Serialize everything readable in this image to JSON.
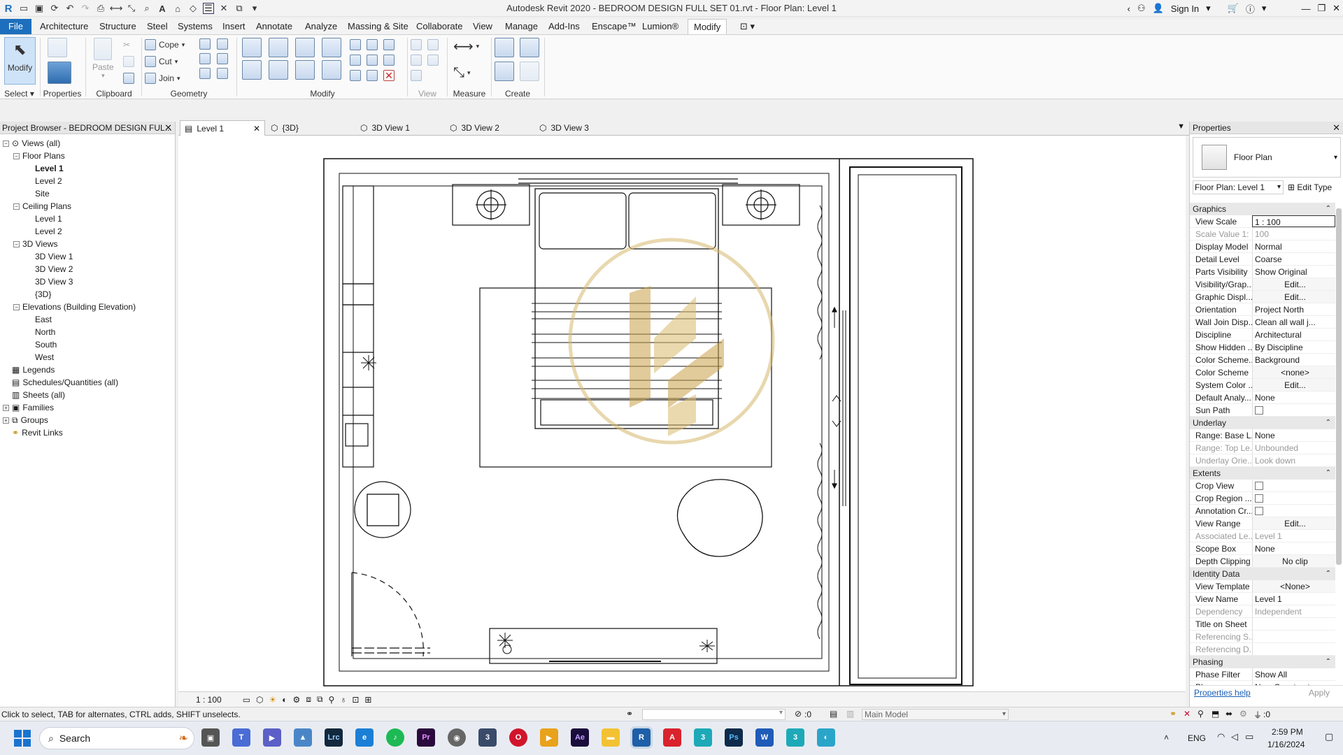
{
  "titlebar": {
    "title": "Autodesk Revit 2020 - BEDROOM DESIGN FULL SET 01.rvt - Floor Plan: Level 1",
    "sign_in": "Sign In"
  },
  "menu": {
    "file": "File",
    "tabs": [
      "Architecture",
      "Structure",
      "Steel",
      "Systems",
      "Insert",
      "Annotate",
      "Analyze",
      "Massing & Site",
      "Collaborate",
      "View",
      "Manage",
      "Add-Ins",
      "Enscape™",
      "Lumion®",
      "Modify"
    ],
    "active": "Modify"
  },
  "ribbon": {
    "select": {
      "modify": "Modify",
      "label": "Select"
    },
    "properties": {
      "label": "Properties"
    },
    "clipboard": {
      "paste": "Paste",
      "label": "Clipboard"
    },
    "geometry": {
      "cope": "Cope",
      "cut": "Cut",
      "join": "Join",
      "label": "Geometry"
    },
    "modify": {
      "label": "Modify"
    },
    "view": {
      "label": "View"
    },
    "measure": {
      "label": "Measure"
    },
    "create": {
      "label": "Create"
    }
  },
  "project_browser": {
    "title": "Project Browser - BEDROOM DESIGN FUL...",
    "tree": [
      {
        "label": "Views (all)",
        "level": 0,
        "exp": "-",
        "icon": "views"
      },
      {
        "label": "Floor Plans",
        "level": 1,
        "exp": "-"
      },
      {
        "label": "Level 1",
        "level": 2,
        "bold": true
      },
      {
        "label": "Level 2",
        "level": 2
      },
      {
        "label": "Site",
        "level": 2
      },
      {
        "label": "Ceiling Plans",
        "level": 1,
        "exp": "-"
      },
      {
        "label": "Level 1",
        "level": 2
      },
      {
        "label": "Level 2",
        "level": 2
      },
      {
        "label": "3D Views",
        "level": 1,
        "exp": "-"
      },
      {
        "label": "3D View 1",
        "level": 2
      },
      {
        "label": "3D View 2",
        "level": 2
      },
      {
        "label": "3D View 3",
        "level": 2
      },
      {
        "label": "{3D}",
        "level": 2
      },
      {
        "label": "Elevations (Building Elevation)",
        "level": 1,
        "exp": "-"
      },
      {
        "label": "East",
        "level": 2
      },
      {
        "label": "North",
        "level": 2
      },
      {
        "label": "South",
        "level": 2
      },
      {
        "label": "West",
        "level": 2
      },
      {
        "label": "Legends",
        "level": 0,
        "icon": "legend"
      },
      {
        "label": "Schedules/Quantities (all)",
        "level": 0,
        "icon": "schedule"
      },
      {
        "label": "Sheets (all)",
        "level": 0,
        "icon": "sheet"
      },
      {
        "label": "Families",
        "level": 0,
        "exp": "+",
        "icon": "family"
      },
      {
        "label": "Groups",
        "level": 0,
        "exp": "+",
        "icon": "group"
      },
      {
        "label": "Revit Links",
        "level": 0,
        "icon": "link"
      }
    ]
  },
  "view_tabs": [
    {
      "label": "Level 1",
      "active": true
    },
    {
      "label": "{3D}"
    },
    {
      "label": "3D View 1"
    },
    {
      "label": "3D View 2"
    },
    {
      "label": "3D View 3"
    }
  ],
  "view_control": {
    "scale": "1 : 100"
  },
  "properties": {
    "title": "Properties",
    "type_name": "Floor Plan",
    "instance": "Floor Plan: Level 1",
    "edit_type": "Edit Type",
    "groups": [
      {
        "name": "Graphics",
        "rows": [
          [
            "View Scale",
            "1 : 100"
          ],
          [
            "Scale Value    1:",
            "100",
            "disabled"
          ],
          [
            "Display Model",
            "Normal"
          ],
          [
            "Detail Level",
            "Coarse"
          ],
          [
            "Parts Visibility",
            "Show Original"
          ],
          [
            "Visibility/Grap...",
            "Edit...",
            "button"
          ],
          [
            "Graphic Displ...",
            "Edit...",
            "button"
          ],
          [
            "Orientation",
            "Project North"
          ],
          [
            "Wall Join Disp...",
            "Clean all wall j..."
          ],
          [
            "Discipline",
            "Architectural"
          ],
          [
            "Show Hidden ...",
            "By Discipline"
          ],
          [
            "Color Scheme...",
            "Background"
          ],
          [
            "Color Scheme",
            "<none>",
            "button"
          ],
          [
            "System Color ...",
            "Edit...",
            "button"
          ],
          [
            "Default Analy...",
            "None"
          ],
          [
            "Sun Path",
            "",
            "check"
          ]
        ]
      },
      {
        "name": "Underlay",
        "rows": [
          [
            "Range: Base L...",
            "None"
          ],
          [
            "Range: Top Le...",
            "Unbounded",
            "disabled"
          ],
          [
            "Underlay Orie...",
            "Look down",
            "disabled"
          ]
        ]
      },
      {
        "name": "Extents",
        "rows": [
          [
            "Crop View",
            "",
            "check"
          ],
          [
            "Crop Region ...",
            "",
            "check"
          ],
          [
            "Annotation Cr...",
            "",
            "check"
          ],
          [
            "View Range",
            "Edit...",
            "button"
          ],
          [
            "Associated Le...",
            "Level 1",
            "disabled"
          ],
          [
            "Scope Box",
            "None"
          ],
          [
            "Depth Clipping",
            "No clip",
            "button"
          ]
        ]
      },
      {
        "name": "Identity Data",
        "rows": [
          [
            "View Template",
            "<None>",
            "button"
          ],
          [
            "View Name",
            "Level 1"
          ],
          [
            "Dependency",
            "Independent",
            "disabled"
          ],
          [
            "Title on Sheet",
            ""
          ],
          [
            "Referencing S...",
            "",
            "disabled"
          ],
          [
            "Referencing D...",
            "",
            "disabled"
          ]
        ]
      },
      {
        "name": "Phasing",
        "rows": [
          [
            "Phase Filter",
            "Show All"
          ],
          [
            "Phase",
            "New Construct"
          ]
        ]
      }
    ],
    "help": "Properties help",
    "apply": "Apply"
  },
  "statusbar": {
    "hint": "Click to select, TAB for alternates, CTRL adds, SHIFT unselects.",
    "count": ":0",
    "model": "Main Model",
    "filter": ":0"
  },
  "taskbar": {
    "search": "Search",
    "lang": "ENG",
    "time": "2:59 PM",
    "date": "1/16/2024"
  }
}
